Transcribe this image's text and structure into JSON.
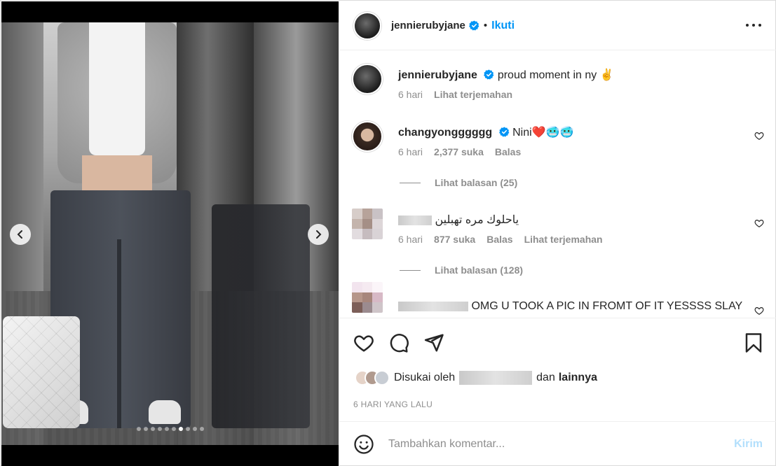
{
  "post": {
    "username": "jennierubyjane",
    "follow_label": "Ikuti",
    "separator": "•",
    "caption": "proud moment in ny",
    "caption_emoji": "✌️",
    "caption_time": "6 hari",
    "caption_translate": "Lihat terjemahan"
  },
  "comments": [
    {
      "username": "changyongggggg",
      "text": "Nini❤️🥶🥶",
      "time": "6 hari",
      "likes": "2,377 suka",
      "reply": "Balas",
      "replies": "Lihat balasan (25)"
    },
    {
      "username": "",
      "text": "ياحلوك مره تهبلين",
      "time": "6 hari",
      "likes": "877 suka",
      "reply": "Balas",
      "translate": "Lihat terjemahan",
      "replies": "Lihat balasan (128)"
    },
    {
      "username": "",
      "text": "OMG U TOOK A PIC IN FROMT OF IT YESSSS SLAY"
    }
  ],
  "liked_by": {
    "prefix": "Disukai oleh",
    "and": "dan",
    "others": "lainnya"
  },
  "post_time": "6 HARI YANG LALU",
  "composer": {
    "placeholder": "Tambahkan komentar...",
    "post_label": "Kirim"
  },
  "carousel": {
    "total": 10,
    "active": 7
  },
  "colors": {
    "accent": "#0095f6",
    "muted": "#8e8e8e",
    "post_disabled": "#b2dffc"
  }
}
